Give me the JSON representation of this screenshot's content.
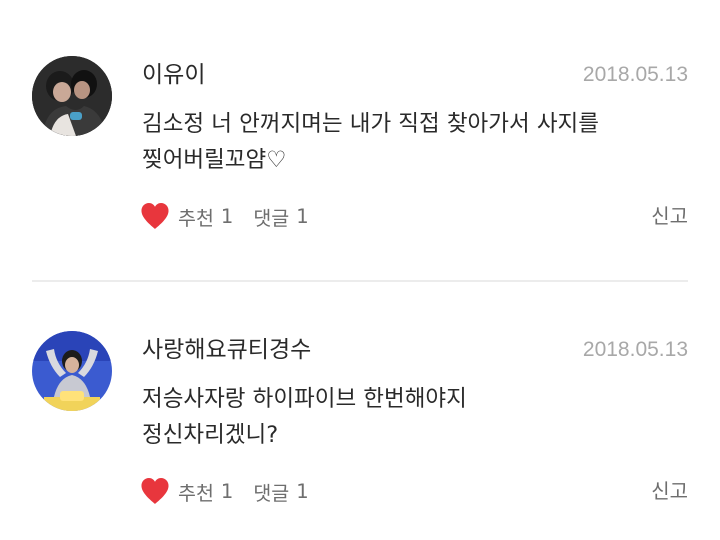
{
  "comments": [
    {
      "username": "이유이",
      "date": "2018.05.13",
      "body_lines": [
        "김소정 너 안꺼지며는 내가 직접 찾아가서 사지를",
        "찢어버릴꼬얌♡"
      ],
      "like_label": "추천",
      "like_count": "1",
      "reply_label": "댓글",
      "reply_count": "1",
      "report_label": "신고"
    },
    {
      "username": "사랑해요큐티경수",
      "date": "2018.05.13",
      "body_lines": [
        "저승사자랑 하이파이브 한번해야지",
        "정신차리겠니?"
      ],
      "like_label": "추천",
      "like_count": "1",
      "reply_label": "댓글",
      "reply_count": "1",
      "report_label": "신고"
    }
  ],
  "icons": {
    "like": "heart-icon"
  },
  "colors": {
    "heart": "#e8363d",
    "username": "#2a2a2a",
    "date": "#a8a8a8",
    "meta": "#6e6e6e",
    "divider": "#ececec"
  }
}
